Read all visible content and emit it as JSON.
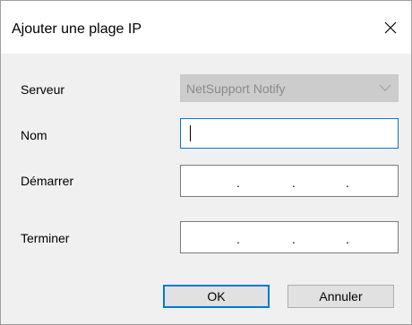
{
  "dialog": {
    "title": "Ajouter une plage IP",
    "close_icon": "close-icon"
  },
  "form": {
    "server_label": "Serveur",
    "server_value": "NetSupport Notify",
    "name_label": "Nom",
    "name_value": "",
    "start_label": "Démarrer",
    "end_label": "Terminer",
    "ip_separator": "."
  },
  "buttons": {
    "ok": "OK",
    "cancel": "Annuler"
  },
  "colors": {
    "focus_border": "#0078d7",
    "disabled_bg": "#cccccc"
  }
}
